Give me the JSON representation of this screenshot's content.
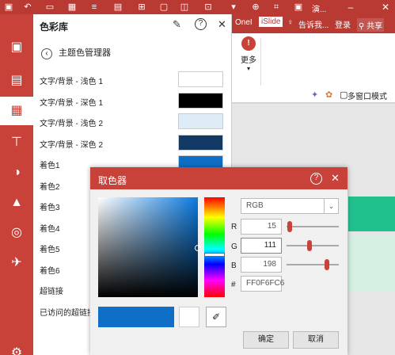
{
  "topbar": {
    "title": "演...",
    "login": "登录",
    "share": "共享",
    "tell_me": "告诉我..."
  },
  "tabs": [
    "OneI",
    "iSlide"
  ],
  "ribbon": {
    "more_label": "更多",
    "multi_window": "多窗口模式"
  },
  "panel": {
    "title": "色彩库",
    "manager": "主题色管理器",
    "rows": [
      {
        "label": "文字/背景 - 浅色 1",
        "color": "#FFFFFF"
      },
      {
        "label": "文字/背景 - 深色 1",
        "color": "#000000"
      },
      {
        "label": "文字/背景 - 浅色 2",
        "color": "#DEECF8"
      },
      {
        "label": "文字/背景 - 深色 2",
        "color": "#123A64"
      },
      {
        "label": "着色1",
        "color": "#0F6FC6"
      },
      {
        "label": "着色2",
        "color": ""
      },
      {
        "label": "着色3",
        "color": ""
      },
      {
        "label": "着色4",
        "color": ""
      },
      {
        "label": "着色5",
        "color": ""
      },
      {
        "label": "着色6",
        "color": ""
      },
      {
        "label": "超链接",
        "color": ""
      },
      {
        "label": "已访问的超链接",
        "color": ""
      }
    ]
  },
  "picker": {
    "title": "取色器",
    "mode": "RGB",
    "r_label": "R",
    "g_label": "G",
    "b_label": "B",
    "hex_label": "#",
    "r": "15",
    "g": "111",
    "b": "198",
    "r_level": 0.06,
    "g_level": 0.44,
    "b_level": 0.78,
    "hex": "FF0F6FC6",
    "new_color": "#0F6FC6",
    "ok": "确定",
    "cancel": "取消"
  }
}
